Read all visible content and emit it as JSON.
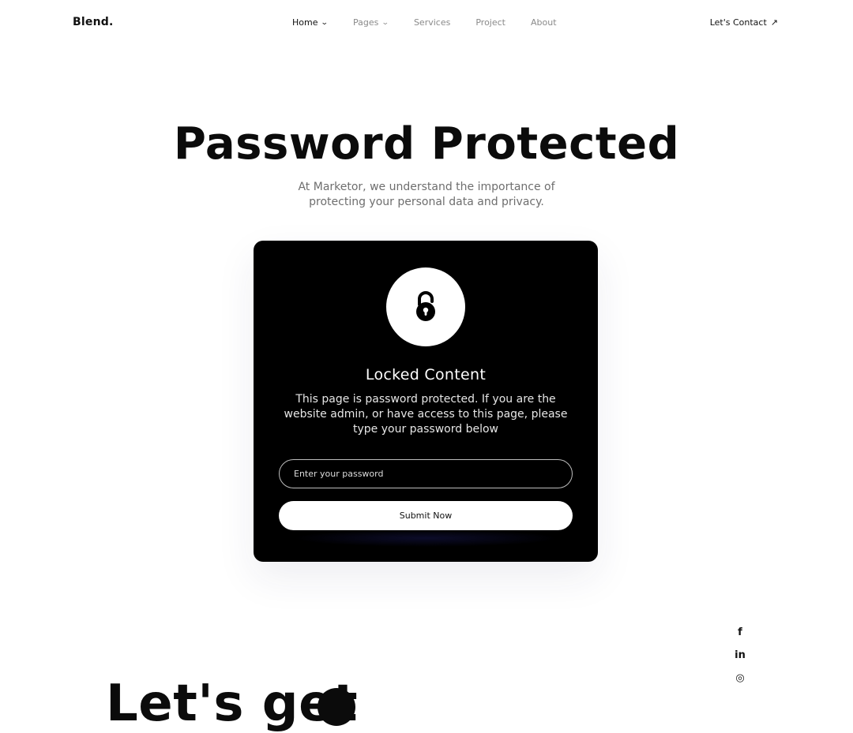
{
  "nav": {
    "logo": "Blend.",
    "items": [
      {
        "label": "Home",
        "has_caret": true,
        "active": true
      },
      {
        "label": "Pages",
        "has_caret": true,
        "active": false
      },
      {
        "label": "Services",
        "has_caret": false,
        "active": false
      },
      {
        "label": "Project",
        "has_caret": false,
        "active": false
      },
      {
        "label": "About",
        "has_caret": false,
        "active": false
      }
    ],
    "cta_label": "Let's Contact",
    "caret_glyph": "⌄",
    "cta_arrow": "↗"
  },
  "hero": {
    "title": "Password Protected",
    "subtitle": "At Marketor, we understand the importance of protecting your personal data and privacy."
  },
  "card": {
    "icon": "padlock-icon",
    "title": "Locked Content",
    "text": "This page is password protected. If you are the website admin, or have access to this page, please type your password below",
    "input_placeholder": "Enter your password",
    "input_value": "",
    "submit_label": "Submit Now"
  },
  "social": [
    {
      "icon": "facebook-icon",
      "glyph": "f"
    },
    {
      "icon": "linkedin-icon",
      "glyph": "in"
    },
    {
      "icon": "instagram-icon",
      "glyph": "◎"
    }
  ],
  "footer": {
    "big_text": "Let's get"
  },
  "colors": {
    "text": "#111111",
    "muted": "#8a8a8a",
    "card_bg": "#000000",
    "button_bg": "#ffffff"
  }
}
